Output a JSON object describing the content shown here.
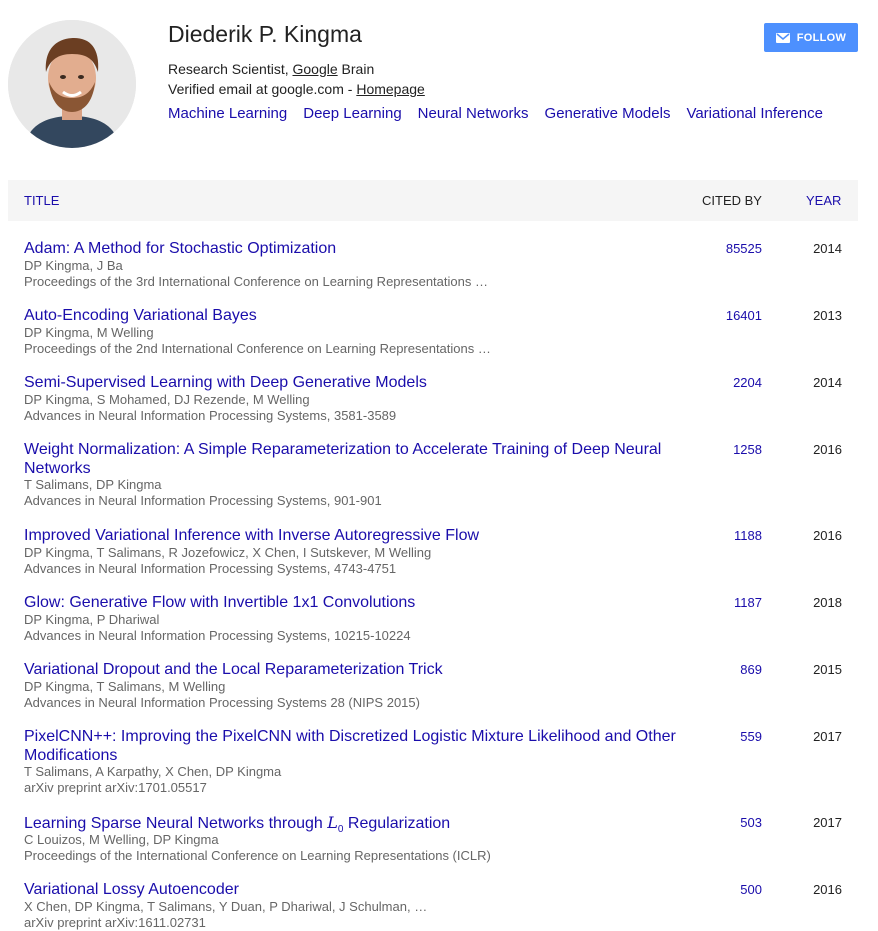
{
  "profile": {
    "name": "Diederik P. Kingma",
    "role_prefix": "Research Scientist, ",
    "org_link": "Google",
    "role_suffix": " Brain",
    "email_text": "Verified email at google.com - ",
    "homepage_link": "Homepage",
    "interests": [
      "Machine Learning",
      "Deep Learning",
      "Neural Networks",
      "Generative Models",
      "Variational Inference"
    ]
  },
  "follow_button": {
    "label": "FOLLOW",
    "icon": "envelope-icon"
  },
  "table": {
    "headers": {
      "title": "TITLE",
      "cited_by": "CITED BY",
      "year": "YEAR"
    },
    "rows": [
      {
        "title": "Adam: A Method for Stochastic Optimization",
        "authors": "DP Kingma, J Ba",
        "venue": "Proceedings of the 3rd International Conference on Learning Representations …",
        "cited": "85525",
        "year": "2014"
      },
      {
        "title": "Auto-Encoding Variational Bayes",
        "authors": "DP Kingma, M Welling",
        "venue": "Proceedings of the 2nd International Conference on Learning Representations …",
        "cited": "16401",
        "year": "2013"
      },
      {
        "title": "Semi-Supervised Learning with Deep Generative Models",
        "authors": "DP Kingma, S Mohamed, DJ Rezende, M Welling",
        "venue": "Advances in Neural Information Processing Systems, 3581-3589",
        "cited": "2204",
        "year": "2014"
      },
      {
        "title": "Weight Normalization: A Simple Reparameterization to Accelerate Training of Deep Neural Networks",
        "authors": "T Salimans, DP Kingma",
        "venue": "Advances in Neural Information Processing Systems, 901-901",
        "cited": "1258",
        "year": "2016"
      },
      {
        "title": "Improved Variational Inference with Inverse Autoregressive Flow",
        "authors": "DP Kingma, T Salimans, R Jozefowicz, X Chen, I Sutskever, M Welling",
        "venue": "Advances in Neural Information Processing Systems, 4743-4751",
        "cited": "1188",
        "year": "2016"
      },
      {
        "title": "Glow: Generative Flow with Invertible 1x1 Convolutions",
        "authors": "DP Kingma, P Dhariwal",
        "venue": "Advances in Neural Information Processing Systems, 10215-10224",
        "cited": "1187",
        "year": "2018"
      },
      {
        "title": "Variational Dropout and the Local Reparameterization Trick",
        "authors": "DP Kingma, T Salimans, M Welling",
        "venue": "Advances in Neural Information Processing Systems 28 (NIPS 2015)",
        "cited": "869",
        "year": "2015"
      },
      {
        "title": "PixelCNN++: Improving the PixelCNN with Discretized Logistic Mixture Likelihood and Other Modifications",
        "authors": "T Salimans, A Karpathy, X Chen, DP Kingma",
        "venue": "arXiv preprint arXiv:1701.05517",
        "cited": "559",
        "year": "2017"
      },
      {
        "title_prefix": "Learning Sparse Neural Networks through ",
        "title_math": "L",
        "title_math_sub": "0",
        "title_suffix": " Regularization",
        "authors": "C Louizos, M Welling, DP Kingma",
        "venue": "Proceedings of the International Conference on Learning Representations (ICLR)",
        "cited": "503",
        "year": "2017"
      },
      {
        "title": "Variational Lossy Autoencoder",
        "authors": "X Chen, DP Kingma, T Salimans, Y Duan, P Dhariwal, J Schulman, …",
        "venue": "arXiv preprint arXiv:1611.02731",
        "cited": "500",
        "year": "2016"
      }
    ]
  }
}
